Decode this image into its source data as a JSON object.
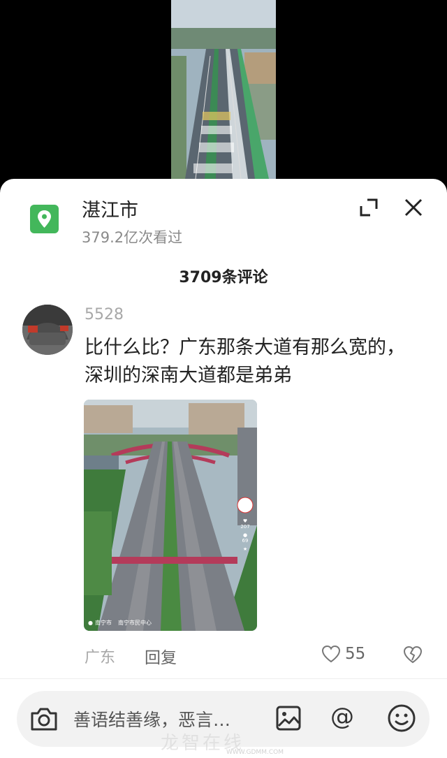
{
  "location": {
    "title": "湛江市",
    "views": "379.2亿次看过"
  },
  "comments_header": "3709条评论",
  "comment": {
    "username": "5528",
    "text": "比什么比？广东那条大道有那么宽的，深圳的深南大道都是弟弟",
    "image": {
      "place_tag": "南宁市",
      "place_detail": "南宁市民中心",
      "like_count": "207",
      "comment_count": "69"
    },
    "region": "广东",
    "reply_label": "回复",
    "likes": "55"
  },
  "input": {
    "placeholder": "善语结善缘，恶言…"
  },
  "icons": [
    "location-pin-icon",
    "expand-icon",
    "close-icon",
    "camera-icon",
    "image-icon",
    "at-icon",
    "emoji-icon",
    "heart-icon",
    "dislike-heart-icon"
  ],
  "colors": {
    "location_green": "#43b75b",
    "text_primary": "#222222",
    "text_secondary": "#a8a8a8"
  },
  "watermark": {
    "main": "龙智在线",
    "sub": "WWW.GDMM.COM"
  }
}
